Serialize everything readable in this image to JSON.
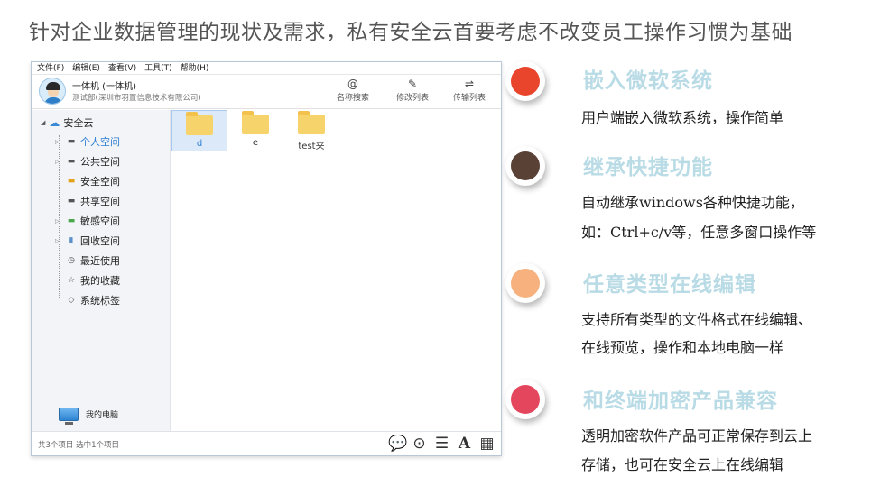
{
  "headline": "针对企业数据管理的现状及需求，私有安全云首要考虑不改变员工操作习惯为基础",
  "app": {
    "menu": [
      "文件(F)",
      "编辑(E)",
      "查看(V)",
      "工具(T)",
      "帮助(H)"
    ],
    "user": {
      "name": "一体机 (一体机)",
      "dept": "测试部(深圳市羽置信息技术有限公司)"
    },
    "tools": [
      {
        "icon": "at-icon",
        "label": "名称搜索"
      },
      {
        "icon": "edit-icon",
        "label": "修改列表"
      },
      {
        "icon": "transfer-icon",
        "label": "传输列表"
      }
    ],
    "tree": {
      "root": "安全云",
      "items": [
        "个人空间",
        "公共空间",
        "安全空间",
        "共享空间",
        "敏感空间",
        "回收空间",
        "最近使用",
        "我的收藏",
        "系统标签"
      ],
      "active": "个人空间"
    },
    "my_computer": "我的电脑",
    "files": [
      {
        "name": "d",
        "selected": true
      },
      {
        "name": "e",
        "selected": false
      },
      {
        "name": "test夹",
        "selected": false
      }
    ],
    "status": "共3个项目  选中1个项目"
  },
  "features": [
    {
      "title": "嵌入微软系统",
      "color": "#e8452c",
      "lines": [
        "用户端嵌入微软系统，操作简单"
      ]
    },
    {
      "title": "继承快捷功能",
      "color": "#5a4135",
      "lines": [
        "自动继承windows各种快捷功能，",
        "如：Ctrl+c/v等，任意多窗口操作等"
      ]
    },
    {
      "title": "任意类型在线编辑",
      "color": "#f7b17e",
      "lines": [
        "支持所有类型的文件格式在线编辑、",
        "在线预览，操作和本地电脑一样"
      ]
    },
    {
      "title": "和终端加密产品兼容",
      "color": "#e4475d",
      "lines": [
        "透明加密软件产品可正常保存到云上",
        "存储，也可在安全云上在线编辑"
      ]
    }
  ]
}
